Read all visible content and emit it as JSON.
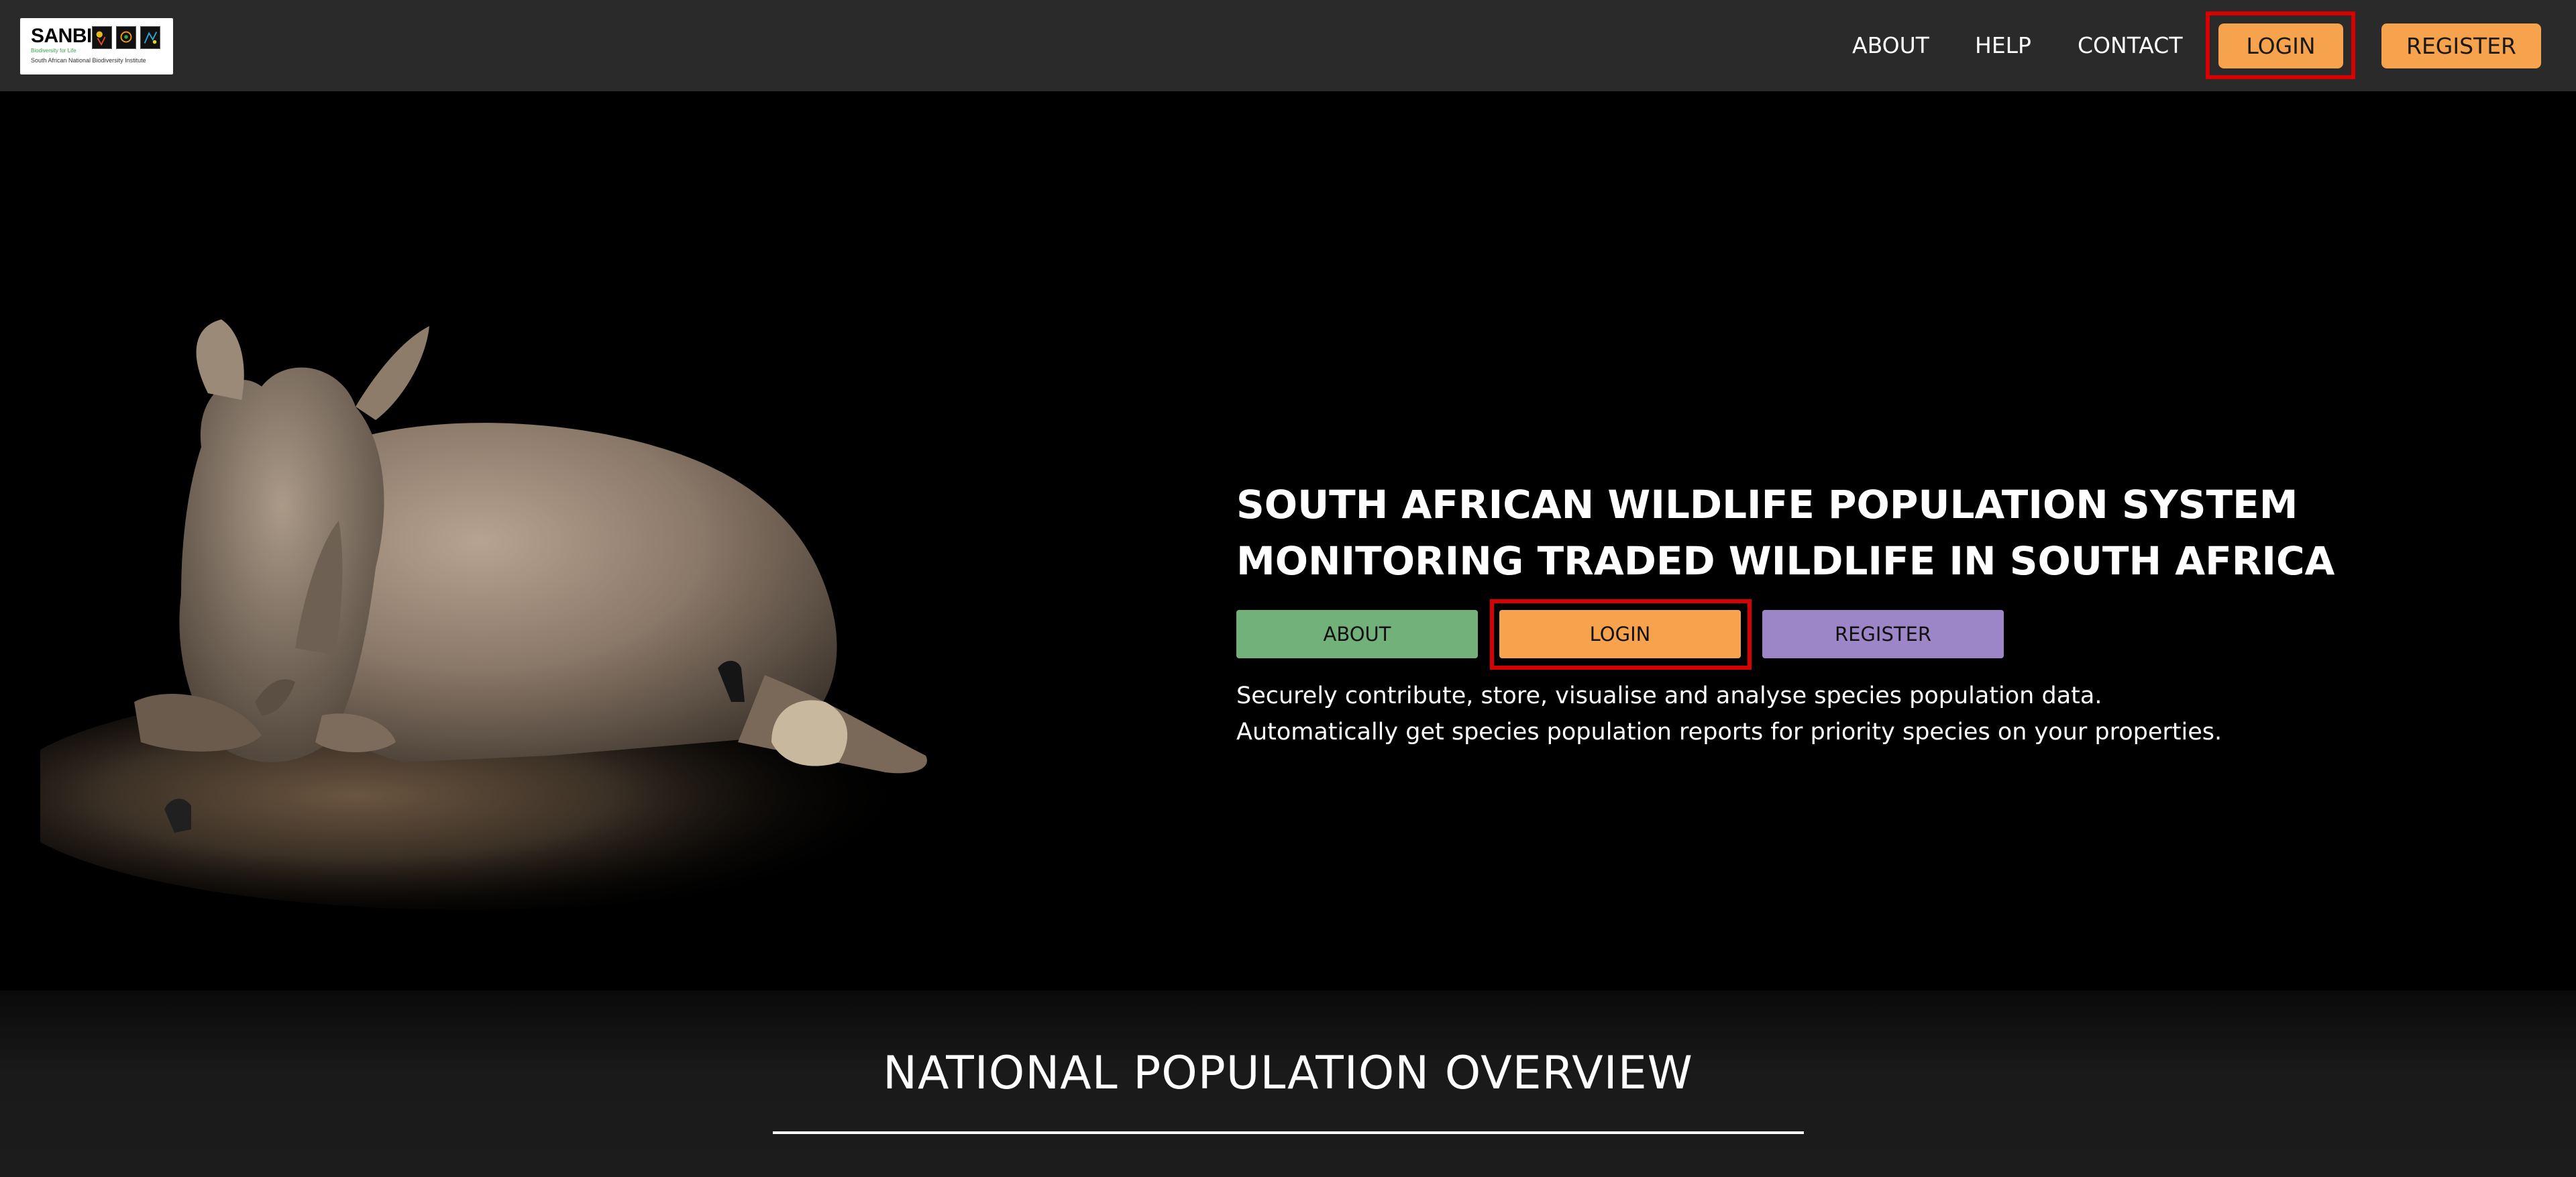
{
  "logo": {
    "name": "SANBI",
    "tagline": "Biodiversity for Life",
    "subtitle": "South African National Biodiversity Institute"
  },
  "nav": {
    "about": "ABOUT",
    "help": "HELP",
    "contact": "CONTACT",
    "login": "LOGIN",
    "register": "REGISTER"
  },
  "hero": {
    "title_line1": "SOUTH AFRICAN WILDLIFE POPULATION SYSTEM",
    "title_line2": "MONITORING TRADED WILDLIFE IN SOUTH AFRICA",
    "about_btn": "ABOUT",
    "login_btn": "LOGIN",
    "register_btn": "REGISTER",
    "description": "Securely contribute, store, visualise and analyse species population data. Automatically get species population reports for priority species on your properties."
  },
  "overview": {
    "title": "NATIONAL POPULATION OVERVIEW"
  },
  "colors": {
    "navbar_bg": "#2a2a2a",
    "accent_orange": "#f7a24c",
    "about_green": "#72b27a",
    "register_purple": "#9d86c7",
    "highlight_red": "#d90000"
  }
}
